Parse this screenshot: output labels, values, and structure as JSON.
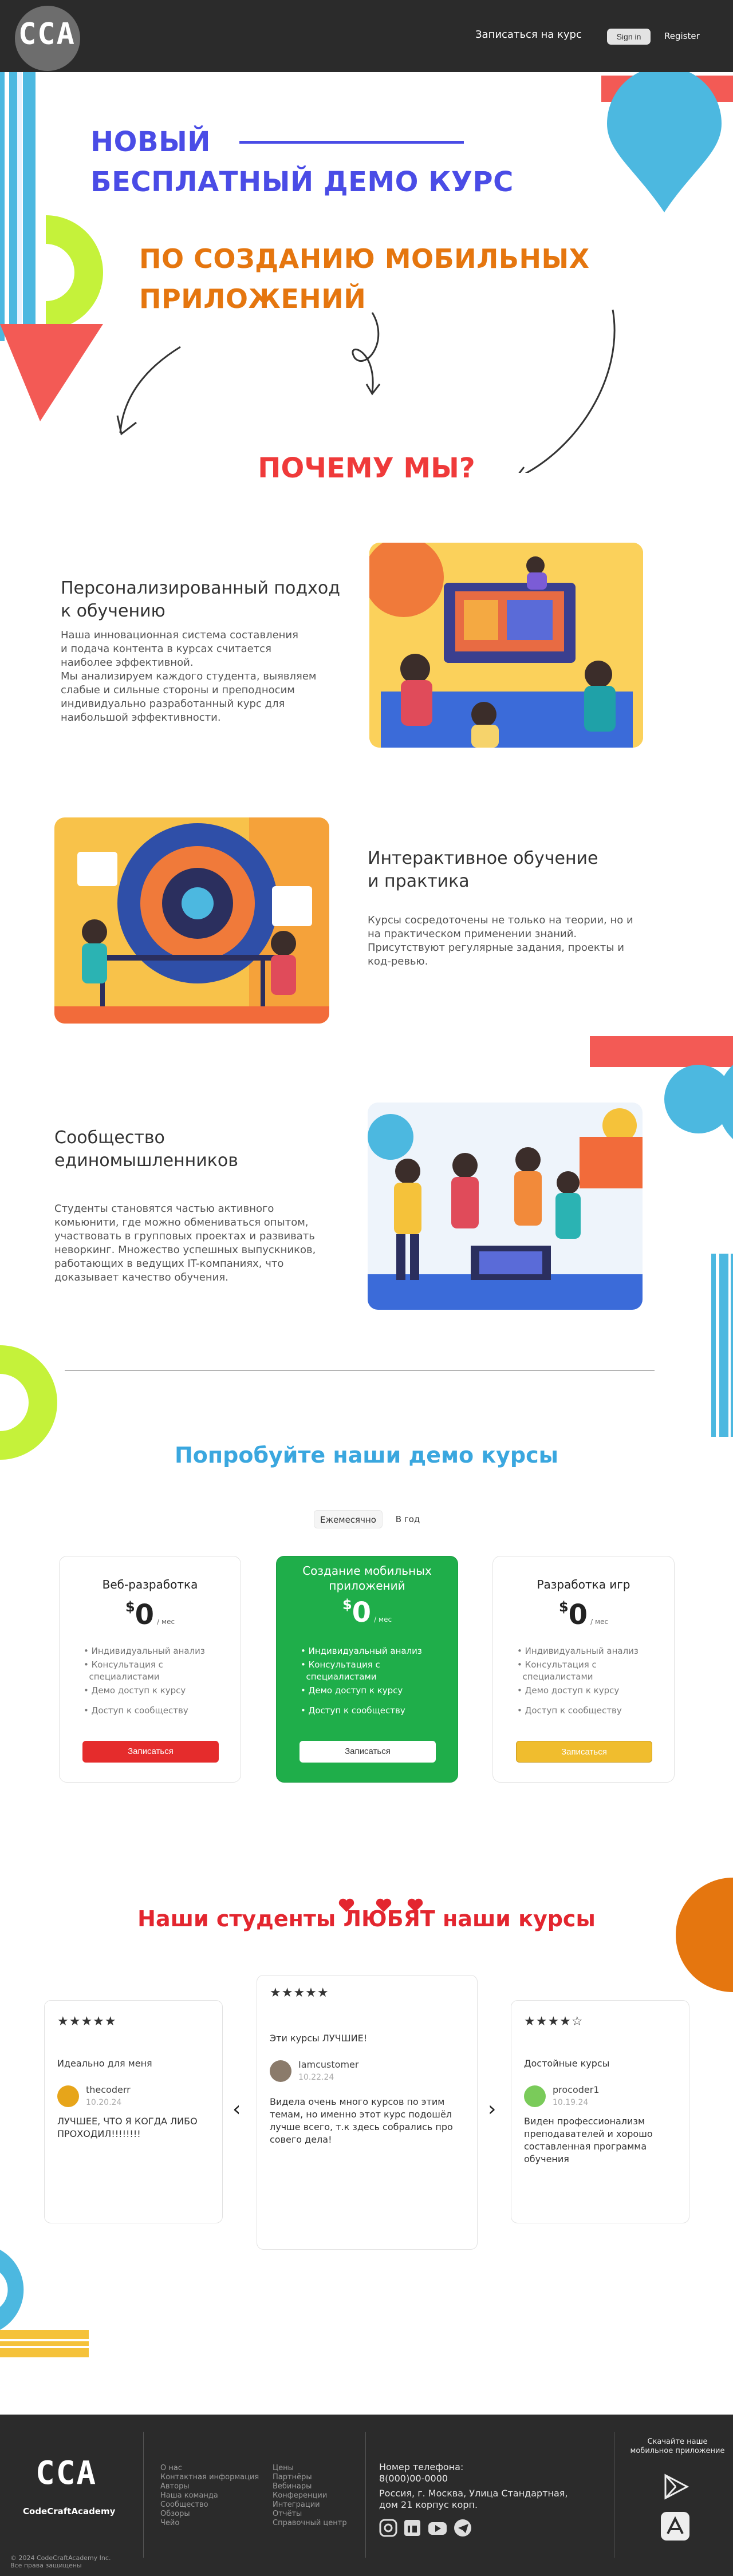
{
  "header": {
    "logo": "CCA",
    "enroll_link": "Записаться на курс",
    "signin_button": "Sign in",
    "register_link": "Register"
  },
  "hero": {
    "line1": "НОВЫЙ",
    "line2": "БЕСПЛАТНЫЙ ДЕМО КУРС",
    "line3": "ПО СОЗДАНИЮ МОБИЛЬНЫХ",
    "line4": "ПРИЛОЖЕНИЙ",
    "why_title": "ПОЧЕМУ МЫ?"
  },
  "features": [
    {
      "title_line1": "Персонализированный подход",
      "title_line2": "к обучению",
      "text_lines": [
        "Наша инновационная система составления",
        "и подача контента в курсах считается",
        "наиболее эффективной.",
        "Мы анализируем каждого студента, выявляем",
        "слабые и сильные стороны и преподносим",
        "индивидуально разработанный курс для",
        "наибольшой эффективности."
      ]
    },
    {
      "title_line1": "Интерактивное обучение",
      "title_line2": "и практика",
      "text_lines": [
        "Курсы сосредоточены не только на теории, но и",
        "на практическом применении знаний.",
        "Присутствуют регулярные задания, проекты и",
        "код-ревью."
      ]
    },
    {
      "title_line1": "Сообщество",
      "title_line2": "единомышленников",
      "text_lines": [
        "Студенты становятся частью активного",
        "комьюнити, где можно обмениваться опытом,",
        "участвовать в групповых проектах и развивать",
        "неворкинг. Множество успешных выпускников,",
        "работающих в ведущих IT-компаниях, что",
        "доказывает качество обучения."
      ]
    }
  ],
  "pricing": {
    "title": "Попробуйте наши демо курсы",
    "toggle_monthly": "Ежемесячно",
    "toggle_yearly": "В год",
    "plans": [
      {
        "title_line1": "Веб-разработка",
        "title_line2": "",
        "currency": "$",
        "price": "0",
        "period": "/ мес",
        "features": [
          "Индивидуальный анализ",
          "Консультация с",
          "специалистами",
          "Демо доступ к курсу",
          "Доступ к сообществу"
        ],
        "button": "Записаться"
      },
      {
        "title_line1": "Создание мобильных",
        "title_line2": "приложений",
        "currency": "$",
        "price": "0",
        "period": "/ мес",
        "features": [
          "Индивидуальный анализ",
          "Консультация с",
          "специалистами",
          "Демо доступ к курсу",
          "Доступ к сообществу"
        ],
        "button": "Записаться"
      },
      {
        "title_line1": "Разработка игр",
        "title_line2": "",
        "currency": "$",
        "price": "0",
        "period": "/ мес",
        "features": [
          "Индивидуальный анализ",
          "Консультация с",
          "специалистами",
          "Демо доступ к курсу",
          "Доступ к сообществу"
        ],
        "button": "Записаться"
      }
    ]
  },
  "reviews": {
    "title_part1": "Наши студенты",
    "title_part2": "ЛЮБЯТ",
    "title_part3": "наши курсы",
    "prev": "‹",
    "next": "›",
    "items": [
      {
        "stars": "★★★★★",
        "headline": "Идеально для меня",
        "name": "thecoderr",
        "date": "10.20.24",
        "text_lines": [
          "ЛУЧШЕЕ, ЧТО Я КОГДА ЛИБО",
          "ПРОХОДИЛ!!!!!!!!"
        ]
      },
      {
        "stars": "★★★★★",
        "headline": "Эти курсы ЛУЧШИЕ!",
        "name": "Iamcustomer",
        "date": "10.22.24",
        "text_lines": [
          "Видела очень много курсов по этим",
          "темам, но именно этот курс подошёл",
          "лучше всего, т.к здесь собрались про",
          "совего дела!"
        ]
      },
      {
        "stars": "★★★★☆",
        "headline": "Достойные курсы",
        "name": "procoder1",
        "date": "10.19.24",
        "text_lines": [
          "Виден профессионализм",
          "преподавателей и хорошо",
          "составленная программа",
          "обучения"
        ]
      }
    ]
  },
  "footer": {
    "logo": "CCA",
    "brand": "CodeCraftAcademy",
    "copyright_line1": "© 2024 CodeCraftAcademy Inc.",
    "copyright_line2": "Все права защищены",
    "links_col1": [
      "О нас",
      "Контактная информация",
      "Авторы",
      "Наша команда",
      "Сообщество",
      "Обзоры",
      "Чейо"
    ],
    "links_col2": [
      "Цены",
      "Партнёры",
      "Вебинары",
      "Конференции",
      "Интеграции",
      "Отчёты",
      "Справочный центр"
    ],
    "phone_label": "Номер телефона:",
    "phone": "8(000)00-0000",
    "address_line1": "Россия, г. Москва, Улица Стандартная,",
    "address_line2": "дом 21 корпус корп.",
    "download_line1": "Скачайте наше",
    "download_line2": "мобильное приложение"
  },
  "colors": {
    "header_bg": "#2b2b2b",
    "hero_blue": "#4a4ce6",
    "hero_orange": "#e5760f",
    "why_red": "#ef3a3a",
    "demo_title_blue": "#3aa7df",
    "featured_green": "#1fae4a",
    "btn_red": "#e52c2c",
    "btn_yellow": "#f0bd2e",
    "love_red": "#e3262f"
  }
}
